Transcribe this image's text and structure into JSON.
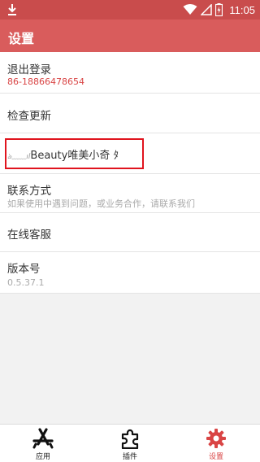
{
  "status_bar": {
    "time": "11:05",
    "icons": [
      "download-icon",
      "wifi-icon",
      "signal-icon",
      "battery-charging-icon"
    ]
  },
  "app_bar": {
    "title": "设置"
  },
  "settings": {
    "logout": {
      "label": "退出登录",
      "phone": "86-18866478654"
    },
    "update": {
      "label": "检查更新"
    },
    "account_name": {
      "label": "Beauty唯美小奇 ﾀ"
    },
    "contact": {
      "label": "联系方式",
      "description": "如果使用中遇到问题，或业务合作，请联系我们"
    },
    "service": {
      "label": "在线客服"
    },
    "version": {
      "label": "版本号",
      "value": "0.5.37.1"
    }
  },
  "bottom_nav": {
    "items": [
      {
        "label": "应用",
        "icon": "app-store-icon",
        "active": false
      },
      {
        "label": "插件",
        "icon": "puzzle-icon",
        "active": false
      },
      {
        "label": "设置",
        "icon": "gear-icon",
        "active": true
      }
    ]
  },
  "colors": {
    "status_bar": "#c94c4c",
    "app_bar": "#d95c5c",
    "accent": "#d94545",
    "highlight_border": "#e0141e",
    "background": "#f2f2f2"
  }
}
